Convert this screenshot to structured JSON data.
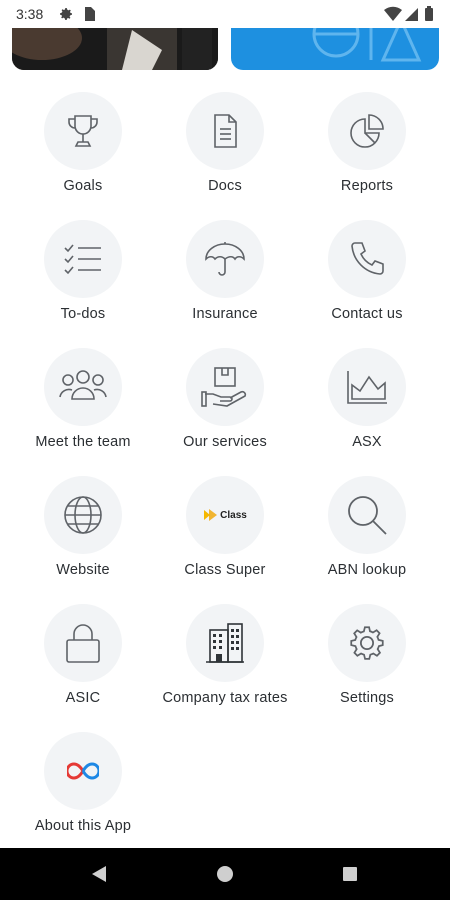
{
  "status_bar": {
    "time": "3:38"
  },
  "tiles": [
    {
      "id": "goals",
      "label": "Goals",
      "icon": "trophy-icon"
    },
    {
      "id": "docs",
      "label": "Docs",
      "icon": "document-icon"
    },
    {
      "id": "reports",
      "label": "Reports",
      "icon": "pie-chart-icon"
    },
    {
      "id": "todos",
      "label": "To-dos",
      "icon": "checklist-icon"
    },
    {
      "id": "insurance",
      "label": "Insurance",
      "icon": "umbrella-icon"
    },
    {
      "id": "contact",
      "label": "Contact us",
      "icon": "phone-icon"
    },
    {
      "id": "team",
      "label": "Meet the team",
      "icon": "people-icon"
    },
    {
      "id": "services",
      "label": "Our services",
      "icon": "hand-box-icon"
    },
    {
      "id": "asx",
      "label": "ASX",
      "icon": "area-chart-icon"
    },
    {
      "id": "website",
      "label": "Website",
      "icon": "globe-icon"
    },
    {
      "id": "classsuper",
      "label": "Class Super",
      "icon": "class-logo-icon",
      "logo_text": "Class"
    },
    {
      "id": "abn",
      "label": "ABN lookup",
      "icon": "magnifier-icon"
    },
    {
      "id": "asic",
      "label": "ASIC",
      "icon": "lock-icon"
    },
    {
      "id": "companytax",
      "label": "Company tax rates",
      "icon": "building-icon"
    },
    {
      "id": "settings",
      "label": "Settings",
      "icon": "gear-icon"
    },
    {
      "id": "about",
      "label": "About this App",
      "icon": "infinity-logo-icon"
    }
  ],
  "colors": {
    "icon_stroke": "#5f6368",
    "circle_bg": "#f2f4f6",
    "accent_blue": "#1e90e0"
  }
}
